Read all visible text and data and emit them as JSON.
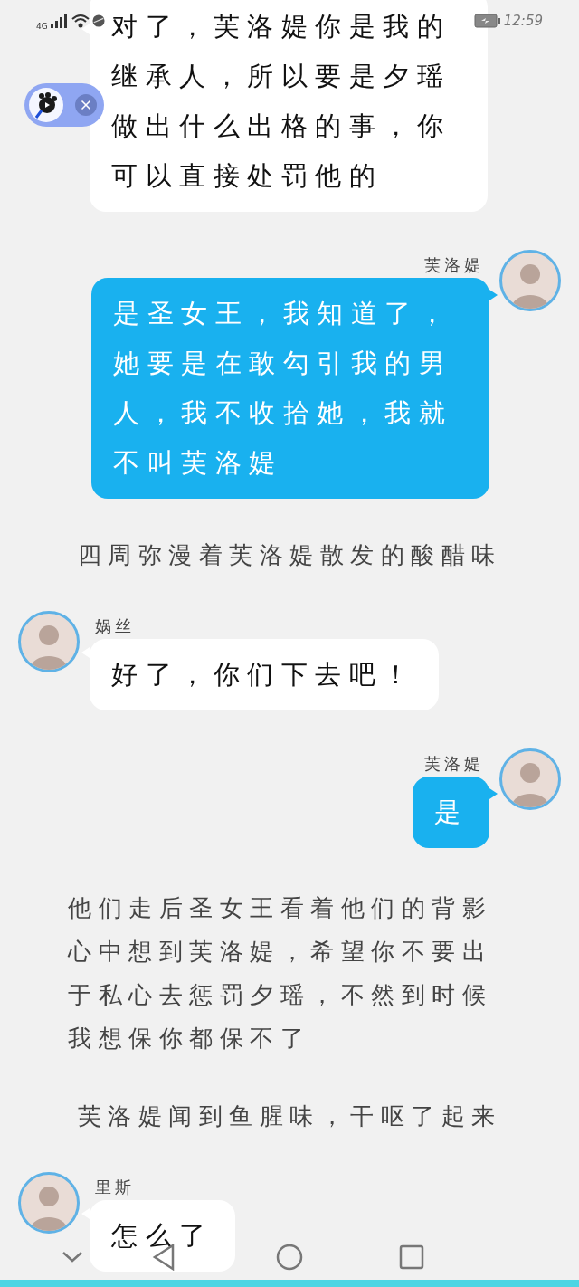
{
  "status_bar": {
    "network": "4G",
    "time": "12:59"
  },
  "messages": [
    {
      "kind": "incoming",
      "text": "对了，芙洛媞你是我的继承人，所以要是夕瑶做出什么出格的事，你可以直接处罚他的"
    },
    {
      "kind": "outgoing",
      "name": "芙洛媞",
      "text": "是圣女王，我知道了，她要是在敢勾引我的男人，我不收拾她，我就不叫芙洛媞"
    },
    {
      "kind": "caption",
      "text": "四周弥漫着芙洛媞散发的酸醋味"
    },
    {
      "kind": "incoming",
      "name": "娲丝",
      "text": "好了，你们下去吧！"
    },
    {
      "kind": "outgoing",
      "name": "芙洛媞",
      "text": "是"
    },
    {
      "kind": "paragraph",
      "text": "他们走后圣女王看着他们的背影心中想到芙洛媞，希望你不要出于私心去惩罚夕瑶，不然到时候我想保你都保不了"
    },
    {
      "kind": "caption",
      "text": "芙洛媞闻到鱼腥味，干呕了起来"
    },
    {
      "kind": "incoming",
      "name": "里斯",
      "text": "怎么了"
    }
  ]
}
